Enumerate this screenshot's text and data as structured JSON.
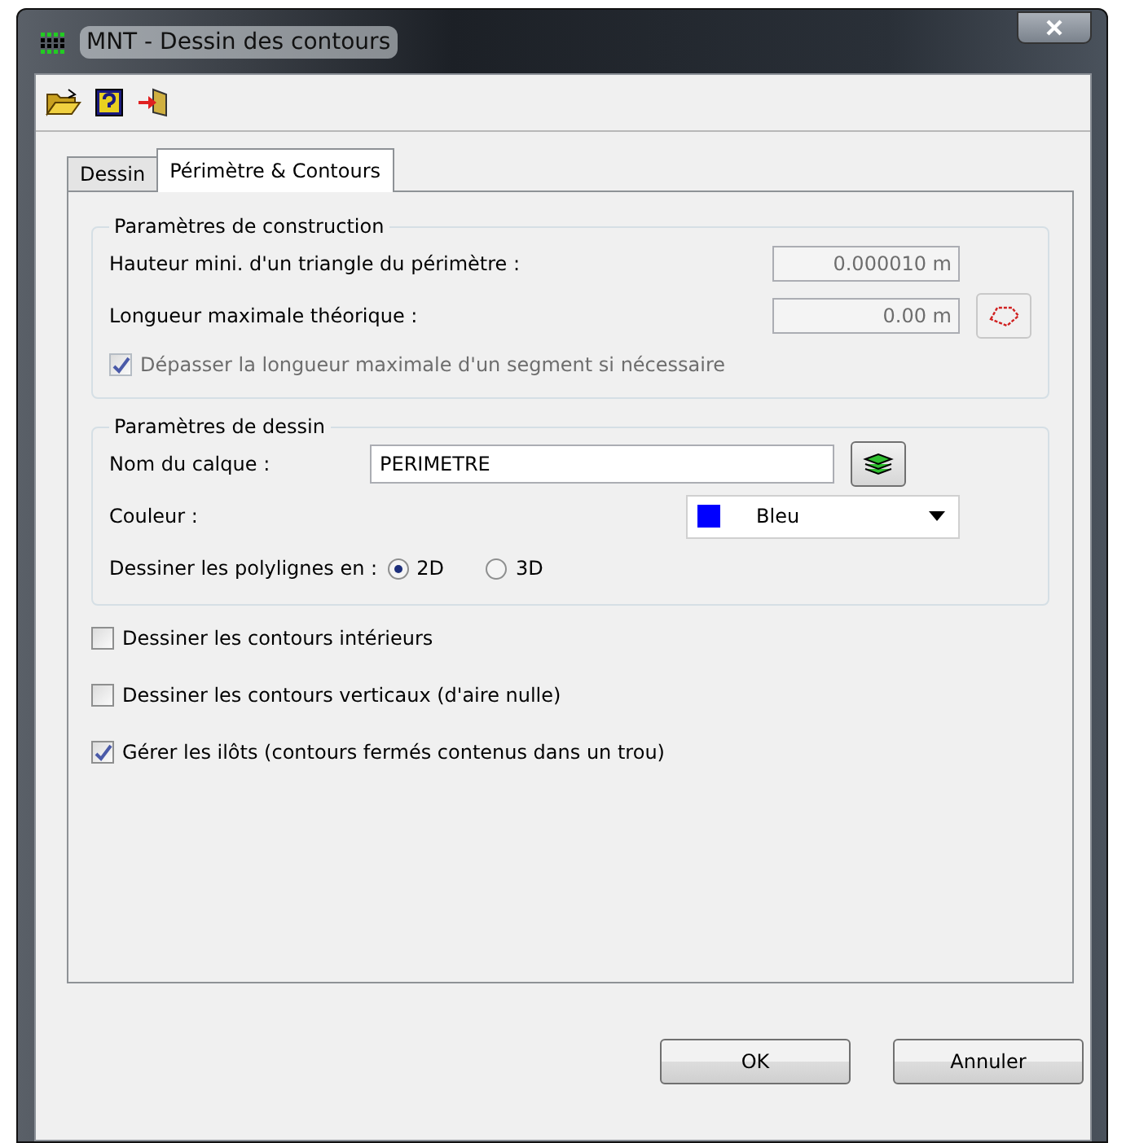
{
  "window": {
    "title": "MNT - Dessin des contours"
  },
  "tabs": [
    {
      "label": "Dessin",
      "selected": false
    },
    {
      "label": "Périmètre & Contours",
      "selected": true
    }
  ],
  "construction": {
    "title": "Paramètres de construction",
    "fields": [
      {
        "label": "Hauteur mini. d'un triangle du périmètre :",
        "value": "0.000010 m",
        "disabled": true,
        "picker": false
      },
      {
        "label": "Longueur maximale théorique :",
        "value": "0.00 m",
        "disabled": true,
        "picker": true
      }
    ],
    "option": {
      "label": "Dépasser la longueur maximale d'un segment si nécessaire",
      "checked": true,
      "disabled": true
    }
  },
  "drawing": {
    "title": "Paramètres de dessin",
    "layer": {
      "label": "Nom du calque :",
      "value": "PERIMETRE"
    },
    "color": {
      "label": "Couleur :",
      "value": "Bleu",
      "color": "#0000ff"
    },
    "mode": {
      "label": "Dessiner les polylignes en :",
      "options": [
        {
          "label": "2D",
          "selected": true
        },
        {
          "label": "3D",
          "selected": false
        }
      ]
    }
  },
  "options": [
    {
      "label": "Dessiner les contours intérieurs",
      "checked": false
    },
    {
      "label": "Dessiner les contours verticaux (d'aire nulle)",
      "checked": false
    },
    {
      "label": "Gérer les ilôts (contours fermés contenus dans un trou)",
      "checked": true
    }
  ],
  "buttons": [
    "OK",
    "Annuler"
  ]
}
